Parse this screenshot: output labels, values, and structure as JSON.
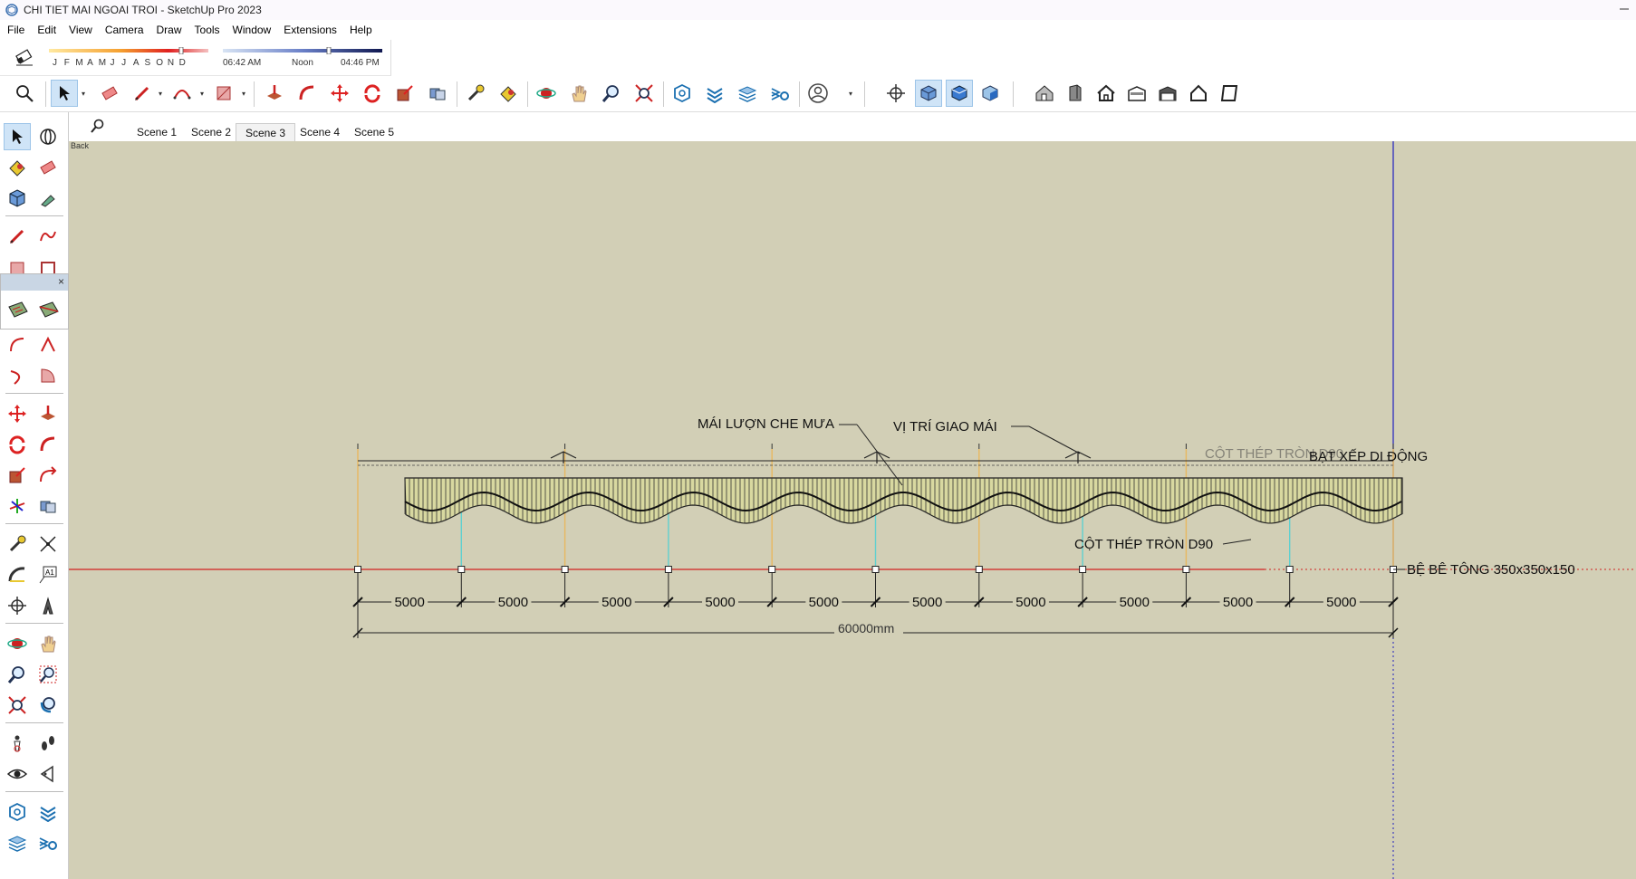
{
  "window": {
    "title": "CHI TIET MAI NGOAI TROI - SketchUp Pro 2023"
  },
  "menu": [
    "File",
    "Edit",
    "View",
    "Camera",
    "Draw",
    "Tools",
    "Window",
    "Extensions",
    "Help"
  ],
  "shadows": {
    "months": [
      "J",
      "F",
      "M",
      "A",
      "M",
      "J",
      "J",
      "A",
      "S",
      "O",
      "N",
      "D"
    ],
    "time_start": "06:42 AM",
    "time_mid": "Noon",
    "time_end": "04:46 PM",
    "month_position": 0.84,
    "time_position": 0.67
  },
  "scenes": {
    "back_label": "Back",
    "tabs": [
      "Scene 1",
      "Scene 2",
      "Scene 3",
      "Scene 4",
      "Scene 5"
    ],
    "active_index": 2
  },
  "drawing": {
    "label_roof": "MÁI LƯỢN CHE MƯA",
    "label_junction": "VỊ TRÍ GIAO MÁI",
    "label_column_top": "CỘT THÉP TRÒN D90",
    "label_awning": "BẠT XẾP DI ĐỘNG",
    "label_column_bottom": "CỘT THÉP TRÒN D90",
    "label_footing": "BỆ BÊ TÔNG 350x350x150",
    "spans": [
      "5000",
      "5000",
      "5000",
      "5000",
      "5000",
      "5000",
      "5000",
      "5000",
      "5000",
      "5000"
    ],
    "total": "60000mm"
  },
  "icons": {
    "app": "sketchup-icon",
    "colors": {
      "viewport_bg": "#d2cfb6",
      "axis_red": "#d22020",
      "axis_blue": "#2020c0",
      "active_tool": "#cfe4f7"
    }
  }
}
